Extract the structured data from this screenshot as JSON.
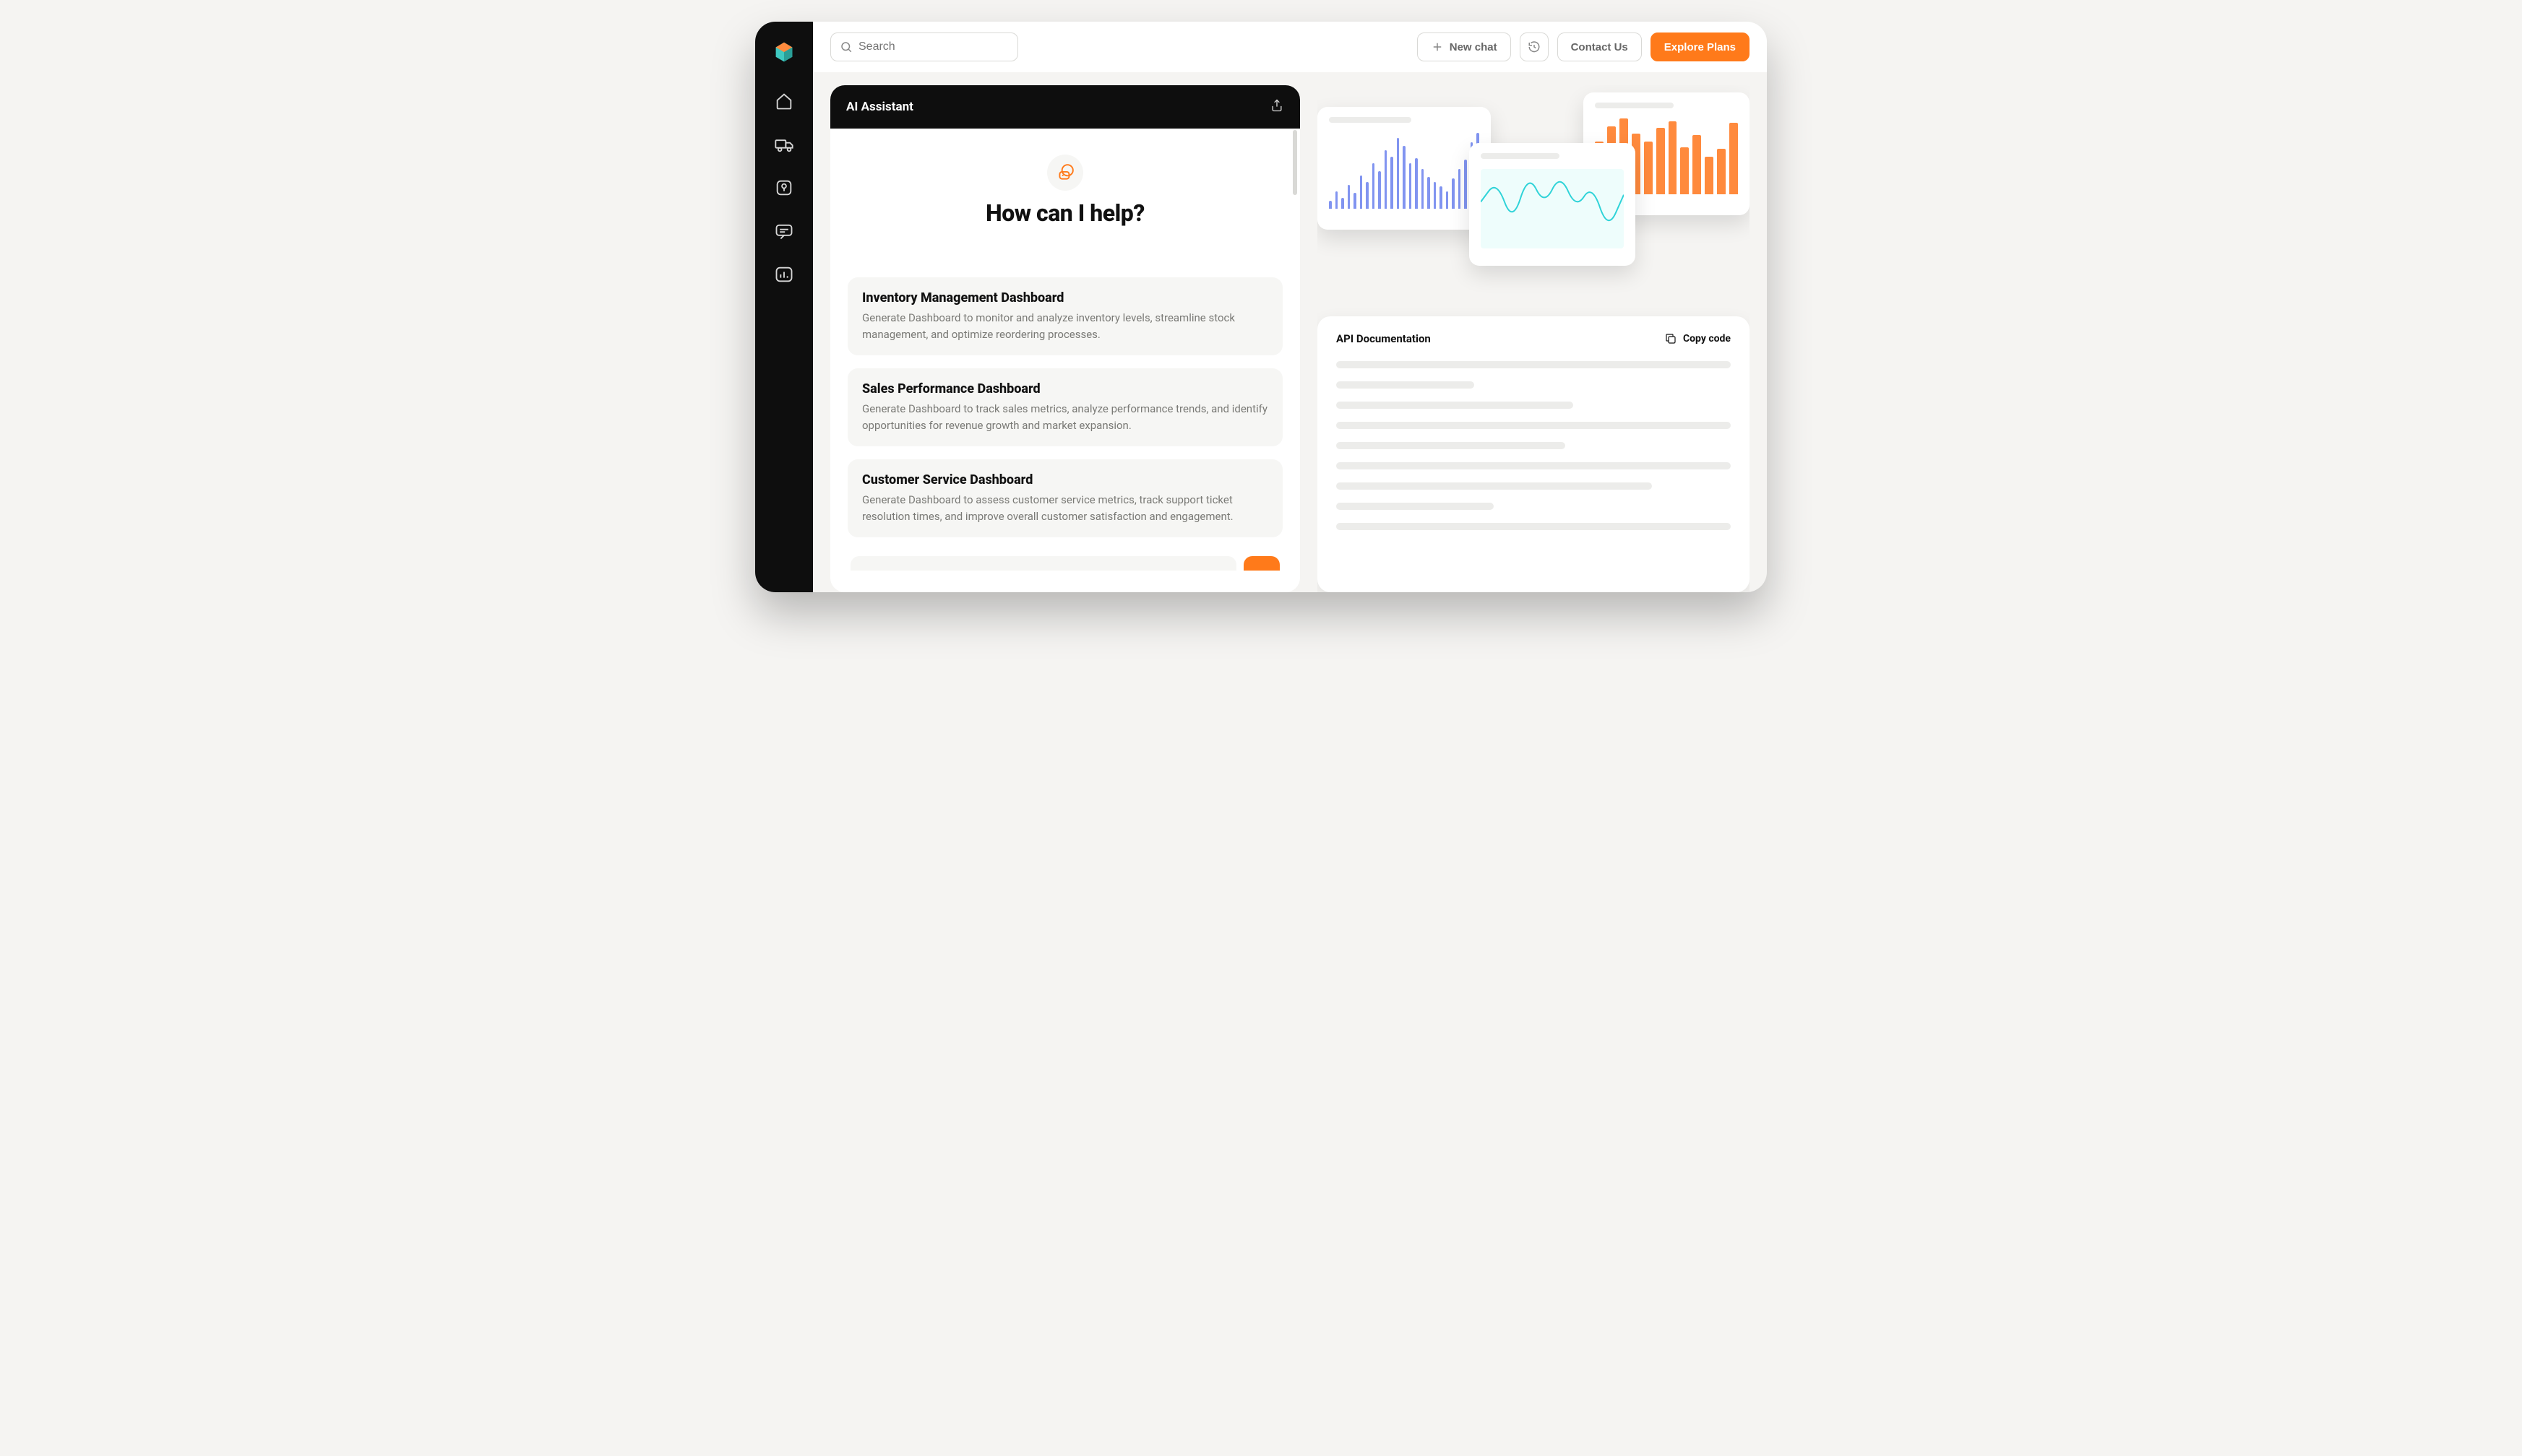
{
  "sidebar": {
    "icons": [
      "home-icon",
      "truck-icon",
      "map-pin-icon",
      "chat-icon",
      "chart-icon"
    ]
  },
  "topbar": {
    "search_placeholder": "Search",
    "new_chat_label": "New chat",
    "contact_label": "Contact Us",
    "explore_label": "Explore Plans"
  },
  "assistant": {
    "header_title": "AI Assistant",
    "hero_title": "How can I help?",
    "suggestions": [
      {
        "title": "Inventory Management Dashboard",
        "desc": "Generate Dashboard to monitor and analyze inventory levels, streamline stock management, and optimize reordering processes."
      },
      {
        "title": "Sales Performance Dashboard",
        "desc": "Generate Dashboard to track sales metrics, analyze performance trends, and identify opportunities for revenue growth and market expansion."
      },
      {
        "title": "Customer Service Dashboard",
        "desc": "Generate Dashboard to assess customer service metrics, track support ticket resolution times, and improve overall customer satisfaction and engagement."
      }
    ]
  },
  "preview": {
    "api_title": "API Documentation",
    "copy_label": "Copy code",
    "placeholder_widths": [
      100,
      35,
      60,
      100,
      58,
      100,
      80,
      40,
      100
    ]
  },
  "chart_data": [
    {
      "type": "bar",
      "series_color": "#8194f0",
      "values": [
        10,
        22,
        14,
        30,
        20,
        42,
        34,
        58,
        48,
        74,
        66,
        90,
        80,
        58,
        64,
        50,
        40,
        34,
        28,
        22,
        38,
        50,
        62,
        84,
        96
      ]
    },
    {
      "type": "line",
      "stroke": "#2fd3d8",
      "fill": "#eefdfc",
      "points": [
        60,
        90,
        30,
        100,
        55,
        100,
        50,
        85,
        20,
        70
      ]
    },
    {
      "type": "bar",
      "series_color": "#ff8a3d",
      "values": [
        70,
        90,
        100,
        80,
        70,
        88,
        96,
        62,
        78,
        50,
        60,
        94
      ]
    }
  ],
  "colors": {
    "accent": "#ff7a1a",
    "dark": "#0e0e0e"
  }
}
